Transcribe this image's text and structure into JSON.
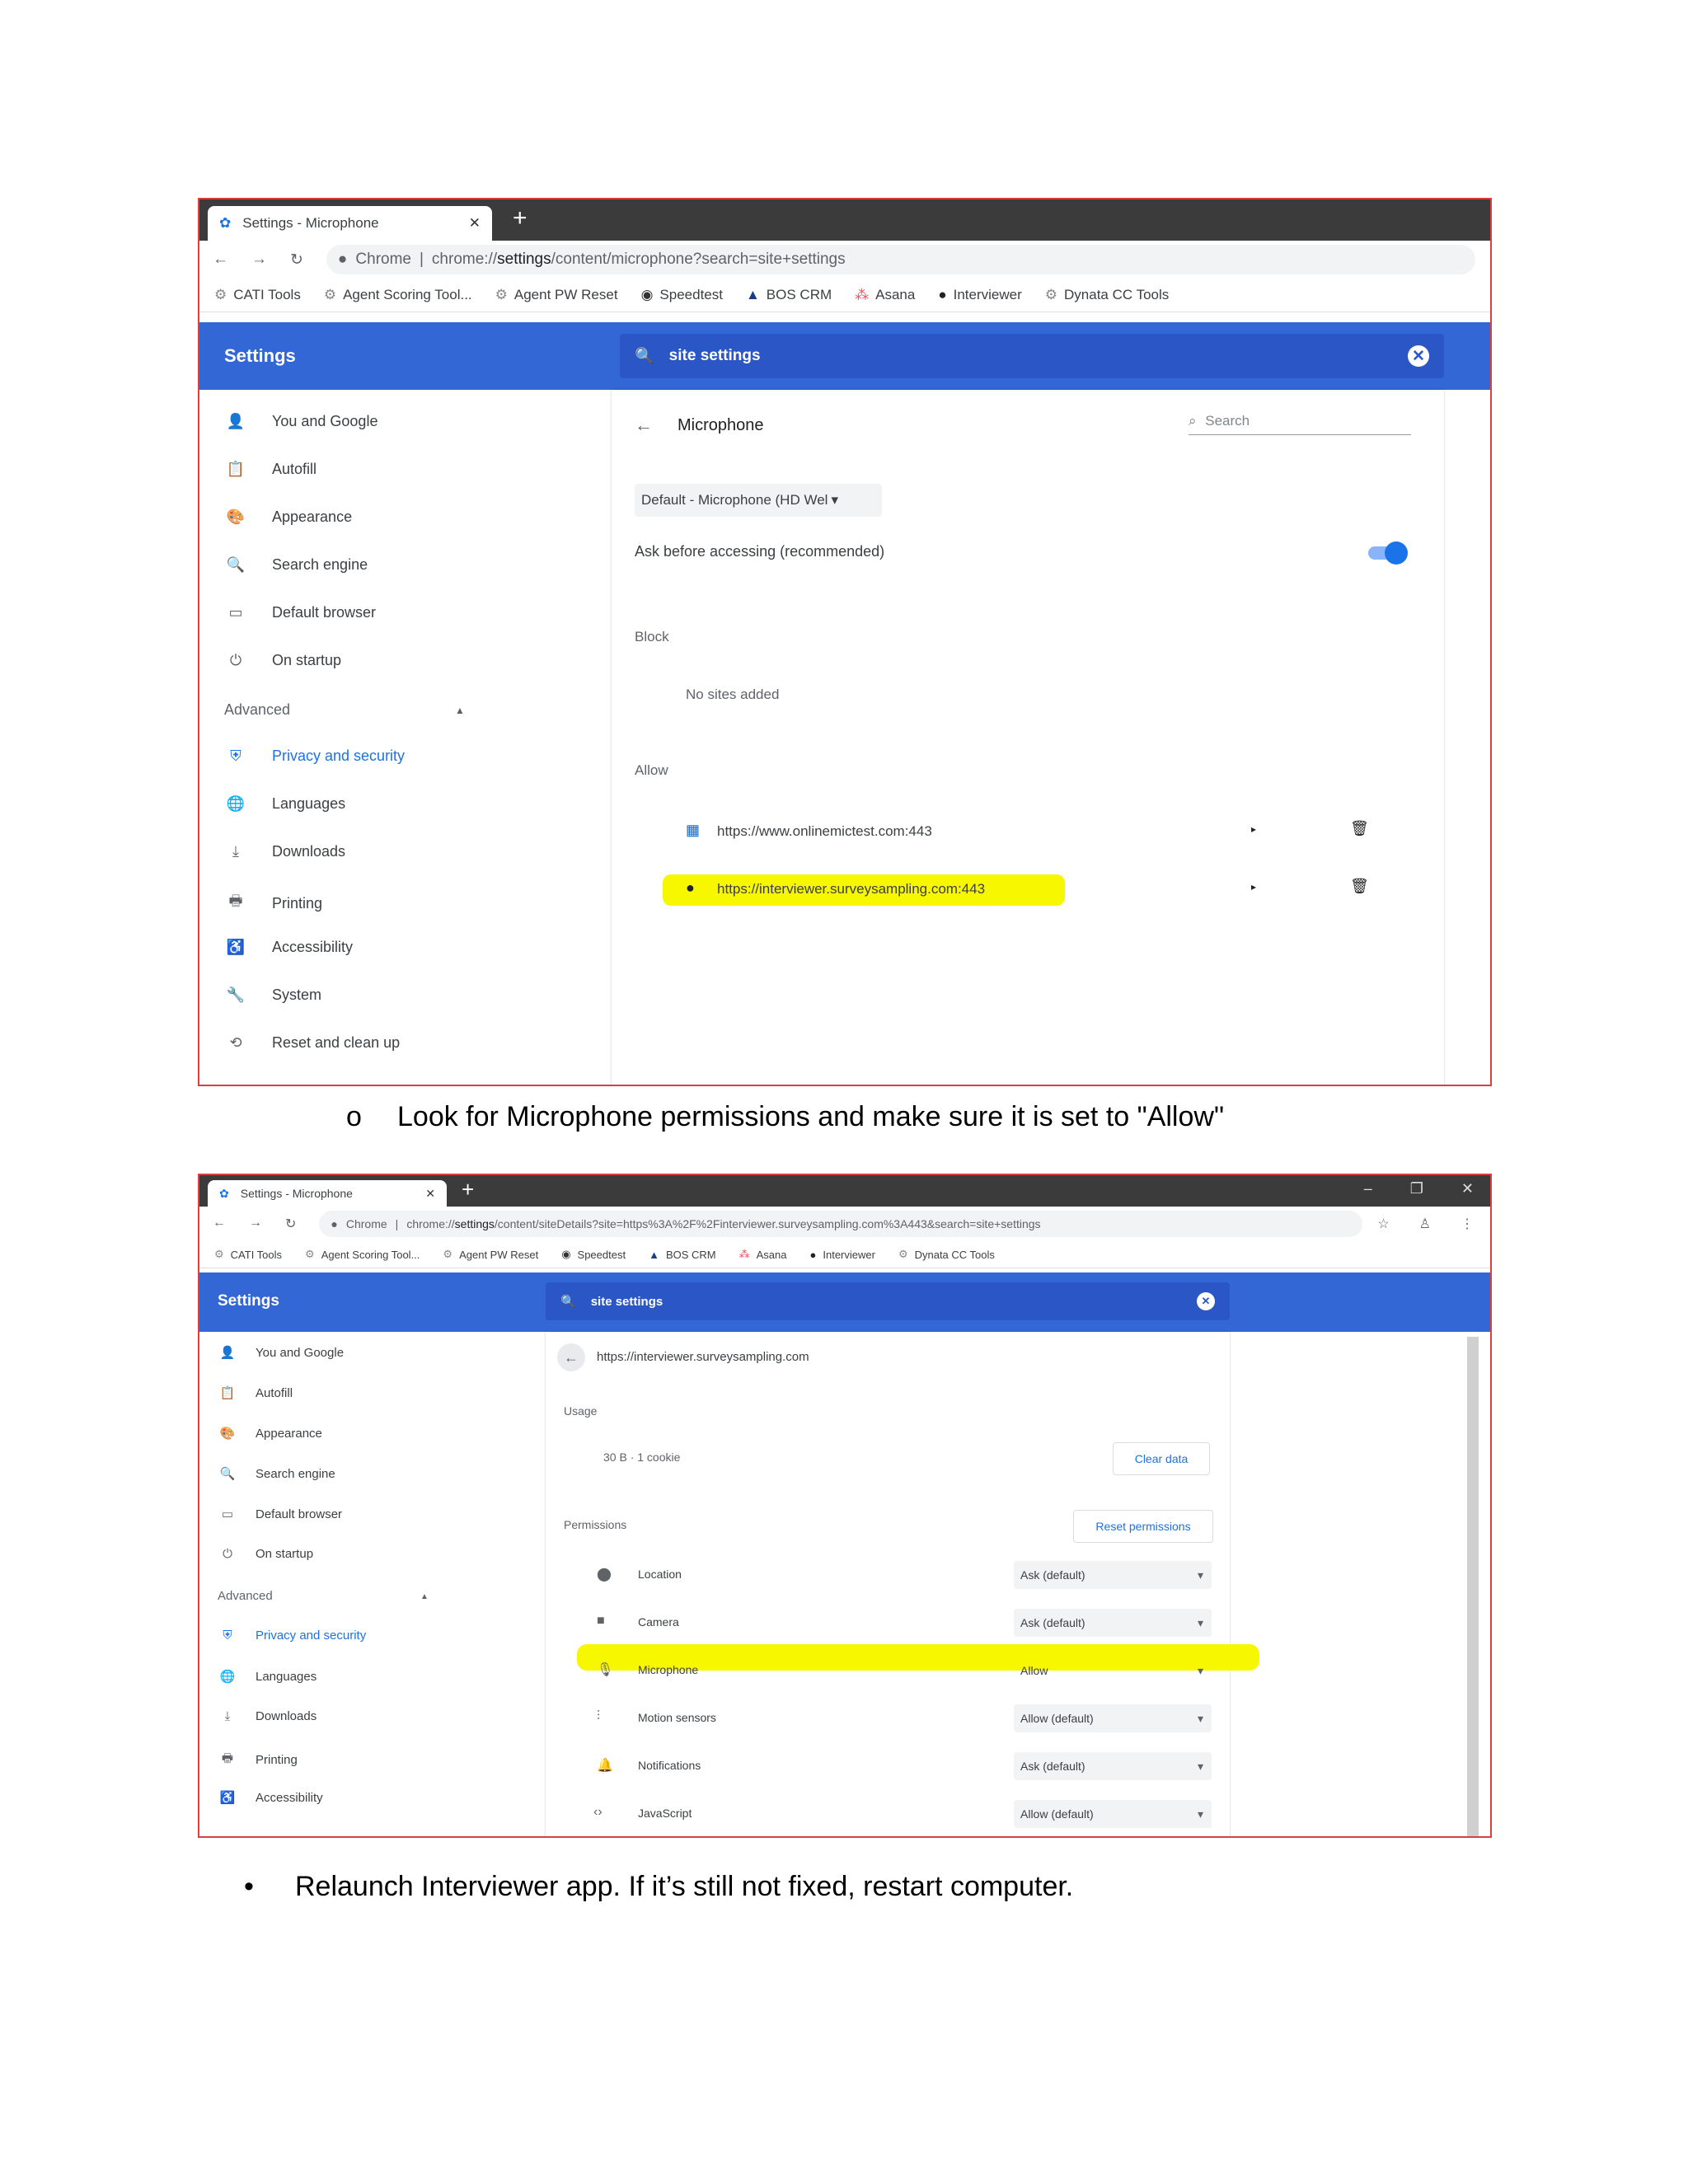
{
  "screenshot1": {
    "tab_title": "Settings - Microphone",
    "url_site": "Chrome",
    "url_prefix": "chrome://",
    "url_bold": "settings",
    "url_rest": "/content/microphone?search=site+settings",
    "bookmarks": [
      "CATI Tools",
      "Agent Scoring Tool...",
      "Agent PW Reset",
      "Speedtest",
      "BOS CRM",
      "Asana",
      "Interviewer",
      "Dynata CC Tools"
    ],
    "header_title": "Settings",
    "search_value": "site settings",
    "sidebar": {
      "items": [
        "You and Google",
        "Autofill",
        "Appearance",
        "Search engine",
        "Default browser",
        "On startup"
      ],
      "advanced_label": "Advanced",
      "advanced_items": [
        "Privacy and security",
        "Languages",
        "Downloads",
        "Printing",
        "Accessibility",
        "System",
        "Reset and clean up"
      ]
    },
    "page_title": "Microphone",
    "search_placeholder": "Search",
    "device_select": "Default - Microphone (HD Wel",
    "ask_label": "Ask before accessing (recommended)",
    "block_heading": "Block",
    "block_empty": "No sites added",
    "allow_heading": "Allow",
    "allow_sites": [
      "https://www.onlinemictest.com:443",
      "https://interviewer.surveysampling.com:443"
    ]
  },
  "caption1": {
    "bullet": "o",
    "text": "Look for Microphone permissions and make sure it is set to \"Allow\""
  },
  "screenshot2": {
    "tab_title": "Settings - Microphone",
    "url_site": "Chrome",
    "url_prefix": "chrome://",
    "url_bold": "settings",
    "url_rest": "/content/siteDetails?site=https%3A%2F%2Finterviewer.surveysampling.com%3A443&search=site+settings",
    "bookmarks": [
      "CATI Tools",
      "Agent Scoring Tool...",
      "Agent PW Reset",
      "Speedtest",
      "BOS CRM",
      "Asana",
      "Interviewer",
      "Dynata CC Tools"
    ],
    "header_title": "Settings",
    "search_value": "site settings",
    "sidebar": {
      "items": [
        "You and Google",
        "Autofill",
        "Appearance",
        "Search engine",
        "Default browser",
        "On startup"
      ],
      "advanced_label": "Advanced",
      "advanced_items": [
        "Privacy and security",
        "Languages",
        "Downloads",
        "Printing",
        "Accessibility"
      ]
    },
    "site_url": "https://interviewer.surveysampling.com",
    "usage_heading": "Usage",
    "usage_value": "30 B · 1 cookie",
    "clear_data": "Clear data",
    "permissions_heading": "Permissions",
    "reset_permissions": "Reset permissions",
    "permissions": [
      {
        "label": "Location",
        "value": "Ask (default)"
      },
      {
        "label": "Camera",
        "value": "Ask (default)"
      },
      {
        "label": "Microphone",
        "value": "Allow"
      },
      {
        "label": "Motion sensors",
        "value": "Allow (default)"
      },
      {
        "label": "Notifications",
        "value": "Ask (default)"
      },
      {
        "label": "JavaScript",
        "value": "Allow (default)"
      }
    ]
  },
  "caption2": {
    "bullet": "•",
    "text": "Relaunch Interviewer app. If it’s still not fixed, restart computer."
  },
  "colors": {
    "header_blue": "#3367d6",
    "link_blue": "#1a73e8",
    "highlight": "#f7f700",
    "frame_red": "#d9413f"
  }
}
